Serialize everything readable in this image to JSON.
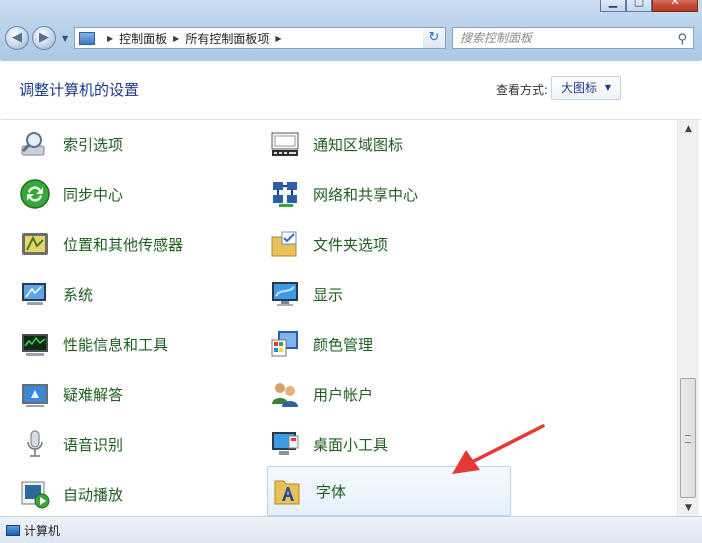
{
  "window": {
    "minimize_glyph": "▁",
    "maximize_glyph": "□",
    "close_glyph": "✕"
  },
  "nav": {
    "back_icon": "arrow-left-icon",
    "forward_icon": "arrow-right-icon",
    "back_glyph": "◀",
    "forward_glyph": "▶",
    "dropdown_glyph": "▼"
  },
  "address_bar": {
    "breadcrumbs": [
      "控制面板",
      "所有控制面板项"
    ],
    "separator": "▶",
    "dropdown_glyph": "▼",
    "refresh_glyph": "↻"
  },
  "search": {
    "placeholder": "搜索控制面板",
    "icon_glyph": "⚲"
  },
  "header": {
    "title": "调整计算机的设置",
    "view_label": "查看方式:",
    "view_value": "大图标",
    "view_caret": "▼"
  },
  "items_left": [
    {
      "label": "索引选项",
      "icon": "index-search-icon"
    },
    {
      "label": "同步中心",
      "icon": "sync-center-icon"
    },
    {
      "label": "位置和其他传感器",
      "icon": "location-sensor-icon"
    },
    {
      "label": "系统",
      "icon": "system-icon"
    },
    {
      "label": "性能信息和工具",
      "icon": "performance-icon"
    },
    {
      "label": "疑难解答",
      "icon": "troubleshoot-icon"
    },
    {
      "label": "语音识别",
      "icon": "microphone-icon"
    },
    {
      "label": "自动播放",
      "icon": "autoplay-icon"
    }
  ],
  "items_right": [
    {
      "label": "通知区域图标",
      "icon": "notification-area-icon"
    },
    {
      "label": "网络和共享中心",
      "icon": "network-icon"
    },
    {
      "label": "文件夹选项",
      "icon": "folder-options-icon"
    },
    {
      "label": "显示",
      "icon": "display-icon"
    },
    {
      "label": "颜色管理",
      "icon": "color-management-icon"
    },
    {
      "label": "用户帐户",
      "icon": "user-accounts-icon"
    },
    {
      "label": "桌面小工具",
      "icon": "desktop-gadgets-icon"
    },
    {
      "label": "字体",
      "icon": "fonts-folder-icon"
    }
  ],
  "scrollbar": {
    "up_glyph": "▲",
    "down_glyph": "▼"
  },
  "statusbar": {
    "text": "计算机"
  },
  "colors": {
    "link_green": "#1f5e1f",
    "title_blue": "#1e3a8a",
    "annotation_red": "#e53935"
  }
}
